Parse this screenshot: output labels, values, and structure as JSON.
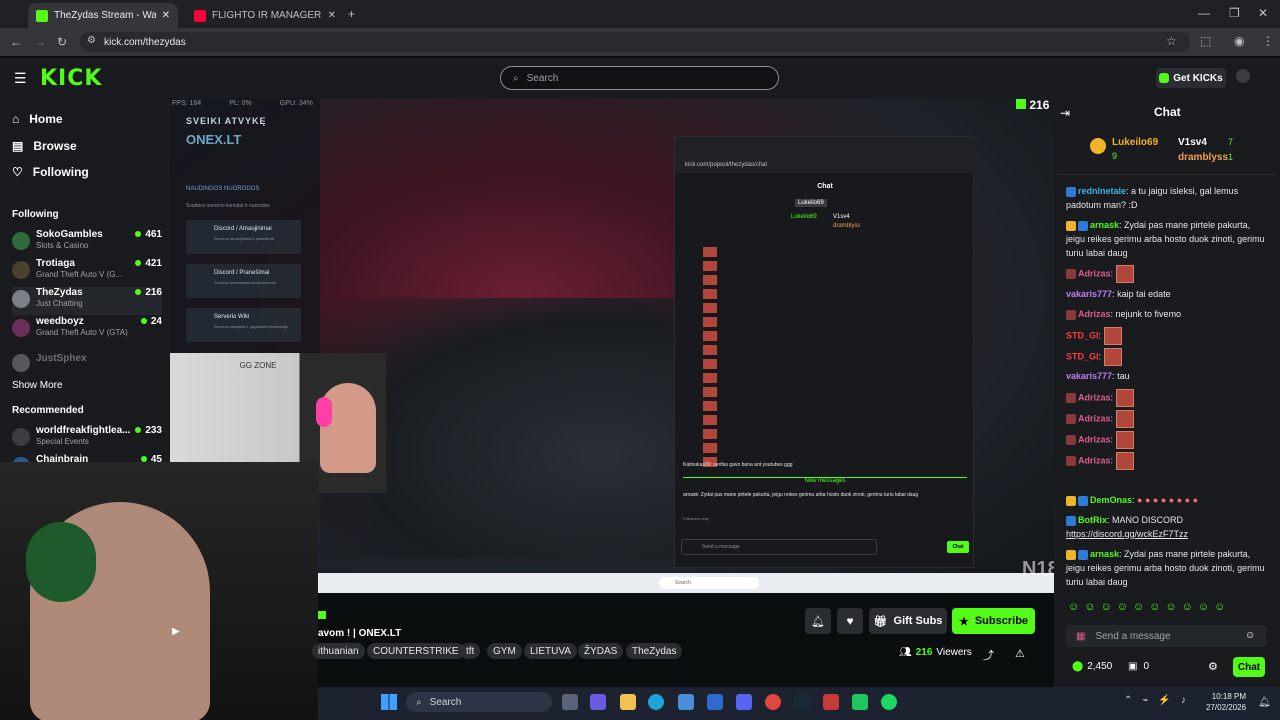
{
  "tabs": [
    {
      "title": "TheZydas Stream - Watch Live o",
      "active": true
    },
    {
      "title": "FLIGHTO IR MANAGERIO PIRM",
      "active": false
    }
  ],
  "address": {
    "url": "kick.com/thezydas"
  },
  "header": {
    "logo": "KICK",
    "search_placeholder": "Search",
    "get_kicks": "Get KICKs"
  },
  "nav": {
    "home": "Home",
    "browse": "Browse",
    "following": "Following"
  },
  "sidebar": {
    "following_title": "Following",
    "channels": [
      {
        "name": "SokoGambles",
        "game": "Slots & Casino",
        "viewers": "461"
      },
      {
        "name": "Trotiaga",
        "game": "Grand Theft Auto V (G...",
        "viewers": "421"
      },
      {
        "name": "TheZydas",
        "game": "Just Chatting",
        "viewers": "216"
      },
      {
        "name": "weedboyz",
        "game": "Grand Theft Auto V (GTA)",
        "viewers": "24"
      },
      {
        "name": "JustSphex",
        "game": "",
        "viewers": ""
      }
    ],
    "show_more": "Show More",
    "recommended_title": "Recommended",
    "recommended": [
      {
        "name": "worldfreakfightlea...",
        "game": "Special Events",
        "viewers": "233"
      },
      {
        "name": "Chainbrain",
        "game": "",
        "viewers": "45"
      }
    ]
  },
  "video": {
    "viewer_count": "216",
    "overlay_fps": "FPS: 184",
    "overlay_pl": "PL: 0%",
    "overlay_gpu": "GPU: 34%",
    "server_welcome": "SVEIKI ATVYKĘ",
    "server_name": "ONEX.LT",
    "server_links_title": "NAUDINGOS NUORODOS",
    "server_links_desc": "Svarbios serverio komatui ir nuorodos",
    "link1": "Discord / Atnaujinimai",
    "link1_desc": "Serverio atnaujinimai ir pakeitimai",
    "link2": "Discord / Pranešimai",
    "link2_desc": "Svarbus pranešimai bendruomenei",
    "link3": "Serverio Wiki",
    "link3_desc": "Serverio taisyklės ir pagalbinė informacija",
    "cam_text": "GG ZONE",
    "popout_url": "kick.com/popout/thezydas/chat",
    "popout_title": "Chat",
    "popout_new": "New messages",
    "popout_send": "Send a message",
    "popout_chat_btn": "Chat",
    "popout_msg1": "Katinukas00: serifas gavo bana ant youtubes ggg",
    "popout_msg2": "arnask: Zydai pas mane pirtele pakurta, jeigu reikes gerimu arba hosto duok zinoti, gerimu turiu labai daug",
    "popout_followers": "Followers only",
    "popout_top1": "Lukeilo69",
    "popout_top2": "V1sv4",
    "popout_top3": "dramblyss",
    "taskbar_search": "Search",
    "n18": "N18"
  },
  "stream": {
    "title_fragment": "avom ! | ONEX.LT",
    "tags": [
      "ithuanian",
      "COUNTERSTRIKE",
      "tft",
      "GYM",
      "LIETUVA",
      "ŽYDAS",
      "TheZydas"
    ],
    "gift_subs": "Gift Subs",
    "subscribe": "Subscribe",
    "viewers": "216",
    "viewers_label": "Viewers"
  },
  "chat": {
    "title": "Chat",
    "top_gifters": [
      {
        "name": "Lukeilo69",
        "count": "9"
      },
      {
        "name": "V1sv4",
        "count": "7"
      },
      {
        "name": "dramblyss",
        "count": "1"
      }
    ],
    "messages": [
      {
        "user": "rednlnetale",
        "text": "a tu jaigu isleksi, gal lemus padotum man? :D",
        "color": "#33b5e5"
      },
      {
        "user": "arnask",
        "text": "Zydai pas mane pirtele pakurta, jeigu reikes gerimu arba hosto duok zinoti, gerimu turiu labai daug",
        "color": "#53fc18"
      },
      {
        "user": "Adrizas",
        "text": "",
        "color": "#e05b8e"
      },
      {
        "user": "vakaris777",
        "text": "kaip tai edate",
        "color": "#c07cf2"
      },
      {
        "user": "Adrizas",
        "text": "nejunk to fivemo",
        "color": "#e05b8e"
      },
      {
        "user": "STD_GI",
        "text": "",
        "color": "#ff3b3b"
      },
      {
        "user": "STD_GI",
        "text": "",
        "color": "#ff3b3b"
      },
      {
        "user": "vakaris777",
        "text": "tau",
        "color": "#c07cf2"
      },
      {
        "user": "Adrizas",
        "text": "",
        "color": "#e05b8e"
      },
      {
        "user": "Adrizas",
        "text": "",
        "color": "#e05b8e"
      },
      {
        "user": "Adrizas",
        "text": "",
        "color": "#e05b8e"
      },
      {
        "user": "Adrizas",
        "text": "",
        "color": "#e05b8e"
      },
      {
        "user": "DemOnas",
        "text": "",
        "color": "#53fc18"
      },
      {
        "user": "BotRix",
        "text": "MANO DISCORD",
        "color": "#53fc18"
      },
      {
        "user": "",
        "text": "https://discord.gg/wckEzF7Tzz",
        "color": "#ffffff"
      },
      {
        "user": "arnask",
        "text": "Zydai pas mane pirtele pakurta, jeigu reikes gerimu arba hosto duok zinoti, gerimu turiu labai daug",
        "color": "#53fc18"
      }
    ],
    "input_placeholder": "Send a message",
    "points": "2,450",
    "gifts": "0",
    "send_label": "Chat"
  },
  "taskbar": {
    "search": "Search",
    "time": "10:18 PM",
    "date": "27/02/2026"
  },
  "colors": {
    "accent": "#53fc18",
    "bg": "#0b0e0f",
    "panel": "#191b1f"
  }
}
